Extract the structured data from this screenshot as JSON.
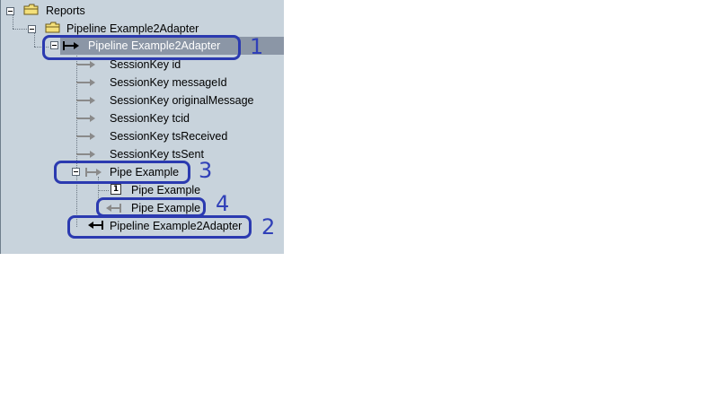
{
  "tree": {
    "nodes": [
      {
        "label": "Reports"
      },
      {
        "label": "Pipeline Example2Adapter"
      },
      {
        "label": "Pipeline Example2Adapter"
      },
      {
        "label": "SessionKey id"
      },
      {
        "label": "SessionKey messageId"
      },
      {
        "label": "SessionKey originalMessage"
      },
      {
        "label": "SessionKey tcid"
      },
      {
        "label": "SessionKey tsReceived"
      },
      {
        "label": "SessionKey tsSent"
      },
      {
        "label": "Pipe Example"
      },
      {
        "label": "Pipe Example",
        "badge": "1"
      },
      {
        "label": "Pipe Example"
      },
      {
        "label": "Pipeline Example2Adapter"
      }
    ]
  },
  "annotations": [
    "1",
    "2",
    "3",
    "4"
  ],
  "colors": {
    "callout": "#2b3ab0",
    "selection": "#8b96a6",
    "panel": "#c8d3dc"
  }
}
